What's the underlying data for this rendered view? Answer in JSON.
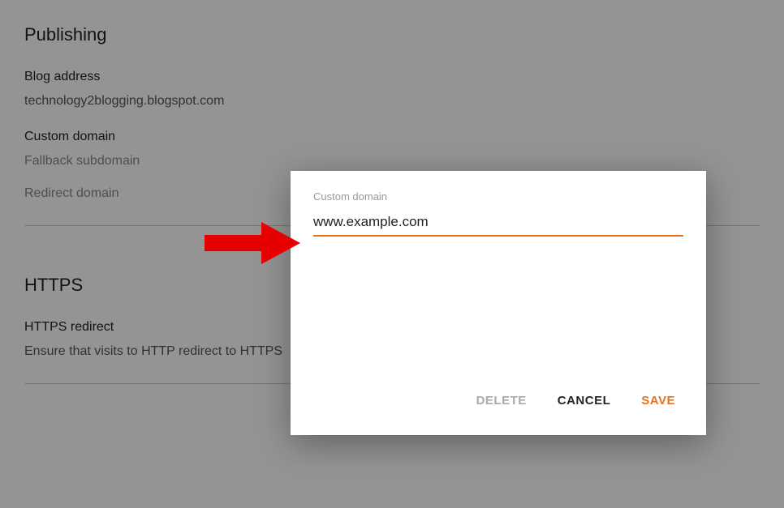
{
  "publishing": {
    "title": "Publishing",
    "blog_address_label": "Blog address",
    "blog_address_value": "technology2blogging.blogspot.com",
    "custom_domain_label": "Custom domain",
    "fallback_subdomain_label": "Fallback subdomain",
    "redirect_domain_label": "Redirect domain"
  },
  "https": {
    "title": "HTTPS",
    "redirect_label": "HTTPS redirect",
    "redirect_desc": "Ensure that visits to HTTP redirect to HTTPS"
  },
  "dialog": {
    "label": "Custom domain",
    "value": "www.example.com",
    "delete_label": "DELETE",
    "cancel_label": "CANCEL",
    "save_label": "SAVE"
  },
  "colors": {
    "accent": "#e8711c"
  }
}
